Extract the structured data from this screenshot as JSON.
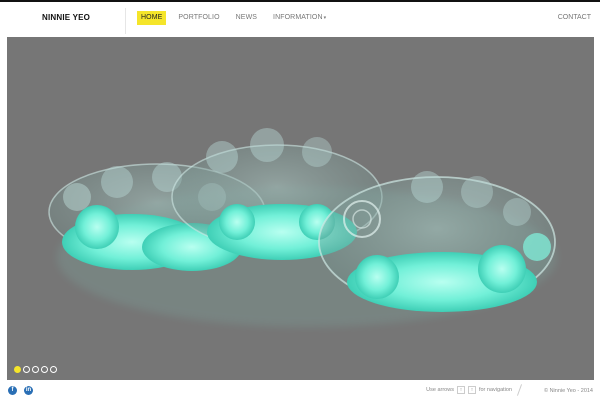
{
  "header": {
    "logo": "NINNIE YEO",
    "nav": [
      {
        "label": "HOME",
        "active": true
      },
      {
        "label": "PORTFOLIO",
        "active": false
      },
      {
        "label": "NEWS",
        "active": false
      },
      {
        "label": "INFORMATION",
        "active": false,
        "dropdown": true
      }
    ],
    "contact": "CONTACT"
  },
  "slider": {
    "slide_count": 5,
    "active_slide": 1,
    "background": "#767676"
  },
  "footer": {
    "social": [
      {
        "icon": "facebook-icon",
        "glyph": "f"
      },
      {
        "icon": "linkedin-icon",
        "glyph": "in"
      }
    ],
    "hint_prefix": "Use arrows",
    "key_left": "↑",
    "key_right": "↑",
    "hint_suffix": "for navigation",
    "copyright": "© Ninnie Yeo - 2014"
  },
  "colors": {
    "accent": "#f5e52a",
    "social": "#2a6fb5",
    "glow": "#6ff0d6"
  }
}
